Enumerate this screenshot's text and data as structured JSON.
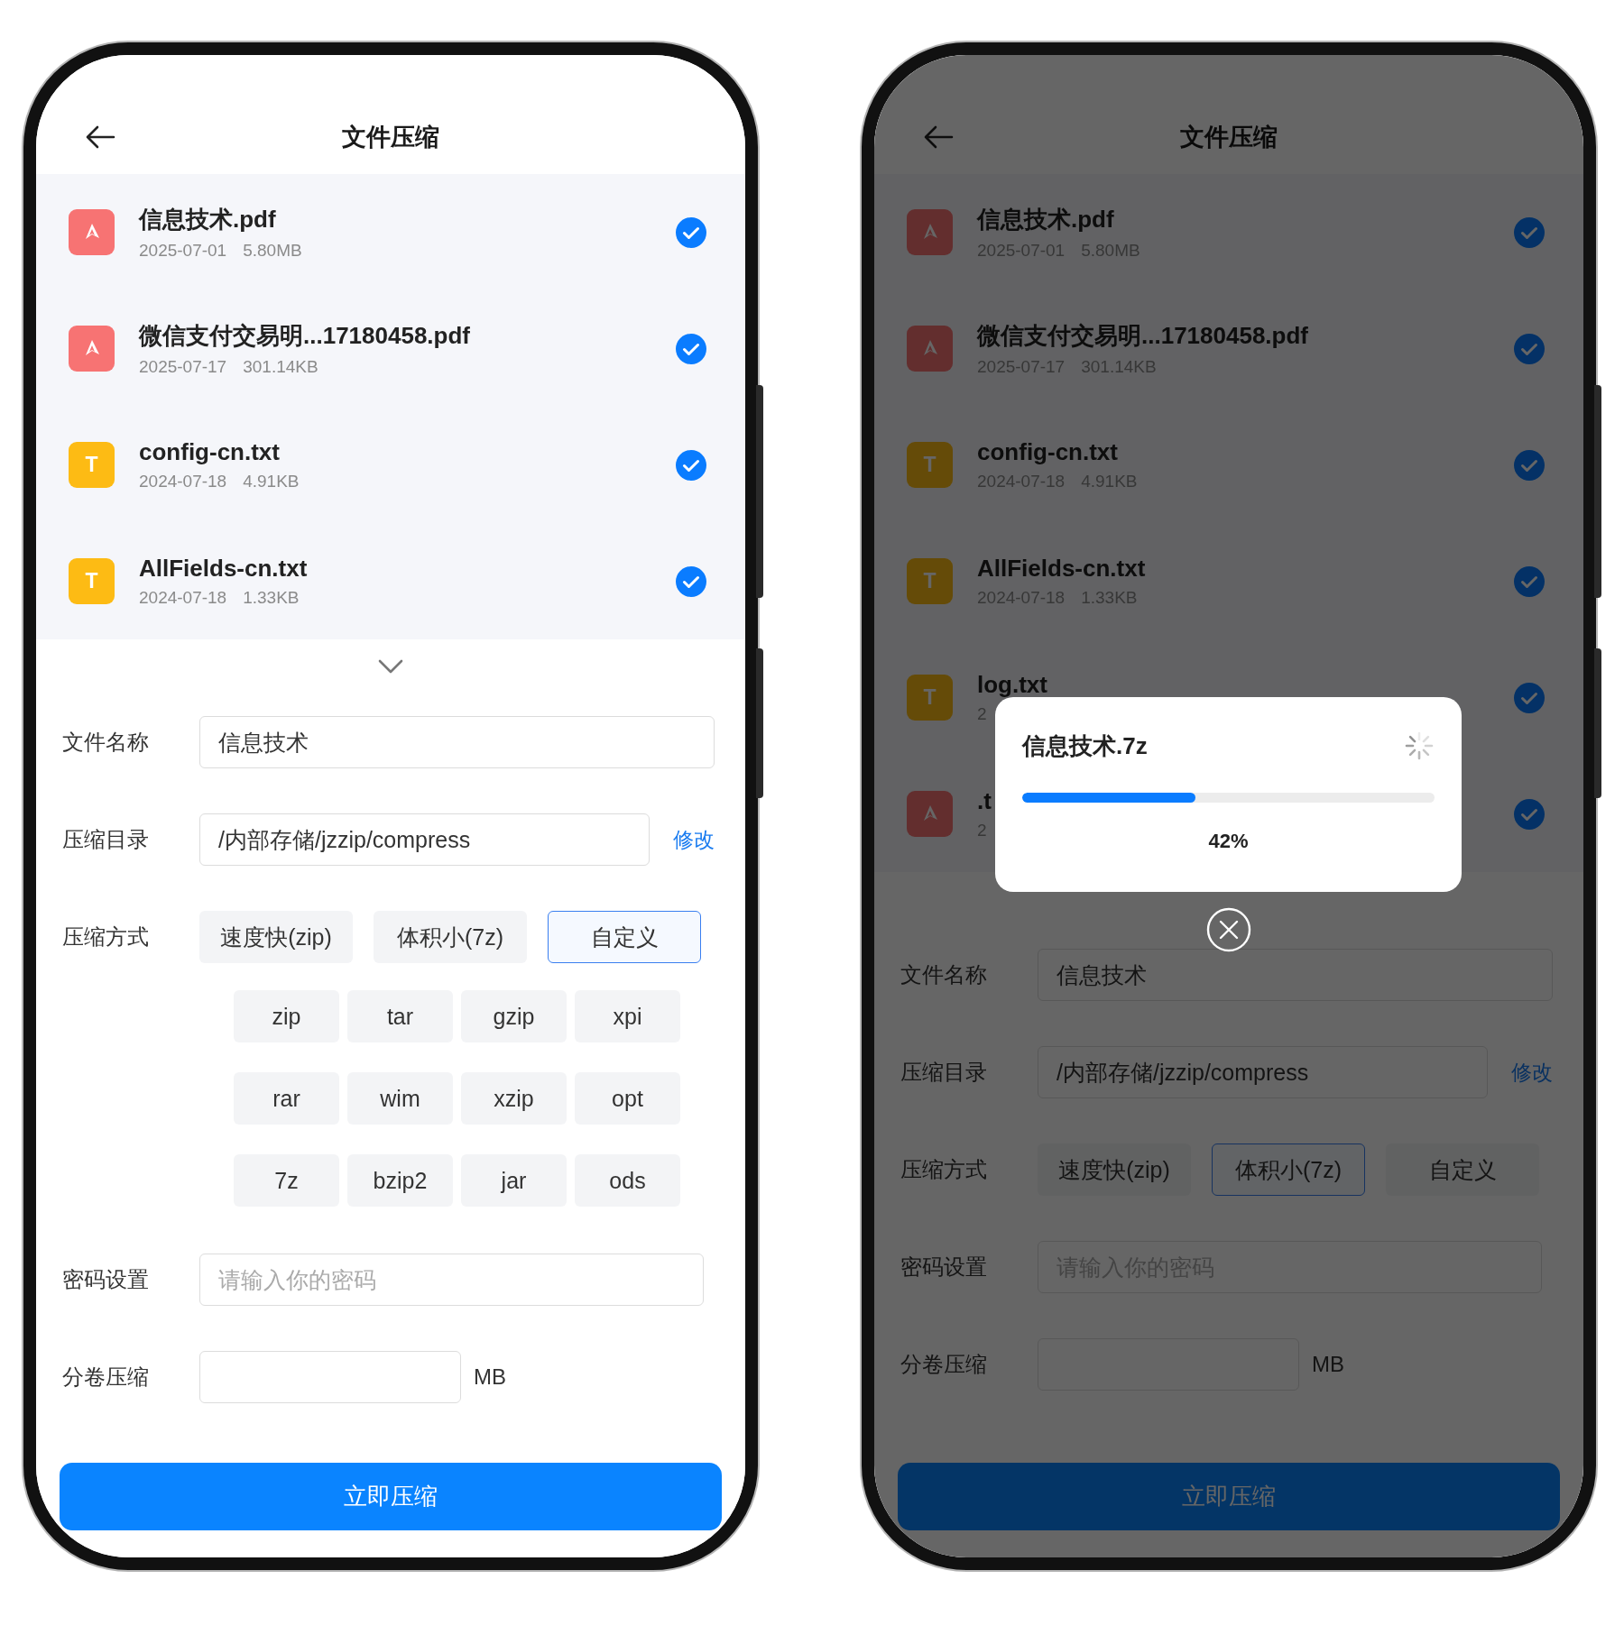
{
  "phones": [
    {
      "title": "文件压缩",
      "files": [
        {
          "kind": "pdf",
          "name": "信息技术.pdf",
          "date": "2025-07-01",
          "size": "5.80MB",
          "checked": true
        },
        {
          "kind": "pdf",
          "name": "微信支付交易明...17180458.pdf",
          "date": "2025-07-17",
          "size": "301.14KB",
          "checked": true
        },
        {
          "kind": "txt",
          "badge": "T",
          "name": "config-cn.txt",
          "date": "2024-07-18",
          "size": "4.91KB",
          "checked": true
        },
        {
          "kind": "txt",
          "badge": "T",
          "name": "AllFields-cn.txt",
          "date": "2024-07-18",
          "size": "1.33KB",
          "checked": true
        }
      ],
      "more_chevron": true,
      "form": {
        "name_label": "文件名称",
        "name_value": "信息技术",
        "dir_label": "压缩目录",
        "dir_value": "/内部存储/jzzip/compress",
        "dir_link": "修改",
        "method_label": "压缩方式",
        "methods": [
          {
            "label": "速度快(zip)",
            "selected": false
          },
          {
            "label": "体积小(7z)",
            "selected": false
          },
          {
            "label": "自定义",
            "selected": true
          }
        ],
        "formats": [
          "zip",
          "tar",
          "gzip",
          "xpi",
          "rar",
          "wim",
          "xzip",
          "opt",
          "7z",
          "bzip2",
          "jar",
          "ods"
        ],
        "password_label": "密码设置",
        "password_placeholder": "请输入你的密码",
        "split_label": "分卷压缩",
        "split_unit": "MB"
      },
      "submit": "立即压缩"
    },
    {
      "title": "文件压缩",
      "files": [
        {
          "kind": "pdf",
          "name": "信息技术.pdf",
          "date": "2025-07-01",
          "size": "5.80MB",
          "checked": true
        },
        {
          "kind": "pdf",
          "name": "微信支付交易明...17180458.pdf",
          "date": "2025-07-17",
          "size": "301.14KB",
          "checked": true
        },
        {
          "kind": "txt",
          "badge": "T",
          "name": "config-cn.txt",
          "date": "2024-07-18",
          "size": "4.91KB",
          "checked": true
        },
        {
          "kind": "txt",
          "badge": "T",
          "name": "AllFields-cn.txt",
          "date": "2024-07-18",
          "size": "1.33KB",
          "checked": true
        },
        {
          "kind": "txt",
          "badge": "T",
          "name": "log.txt",
          "date": "2",
          "checked": true
        },
        {
          "kind": "pdf",
          "name": ".t",
          "date": "2",
          "checked": true
        }
      ],
      "more_chevron": false,
      "form": {
        "name_label": "文件名称",
        "name_value": "信息技术",
        "dir_label": "压缩目录",
        "dir_value": "/内部存储/jzzip/compress",
        "dir_link": "修改",
        "method_label": "压缩方式",
        "methods": [
          {
            "label": "速度快(zip)",
            "selected": false
          },
          {
            "label": "体积小(7z)",
            "selected": true
          },
          {
            "label": "自定义",
            "selected": false
          }
        ],
        "password_label": "密码设置",
        "password_placeholder": "请输入你的密码",
        "split_label": "分卷压缩",
        "split_unit": "MB"
      },
      "submit": "立即压缩",
      "progress_dialog": {
        "title": "信息技术.7z",
        "level": 0.42,
        "reading": "42%"
      }
    }
  ]
}
